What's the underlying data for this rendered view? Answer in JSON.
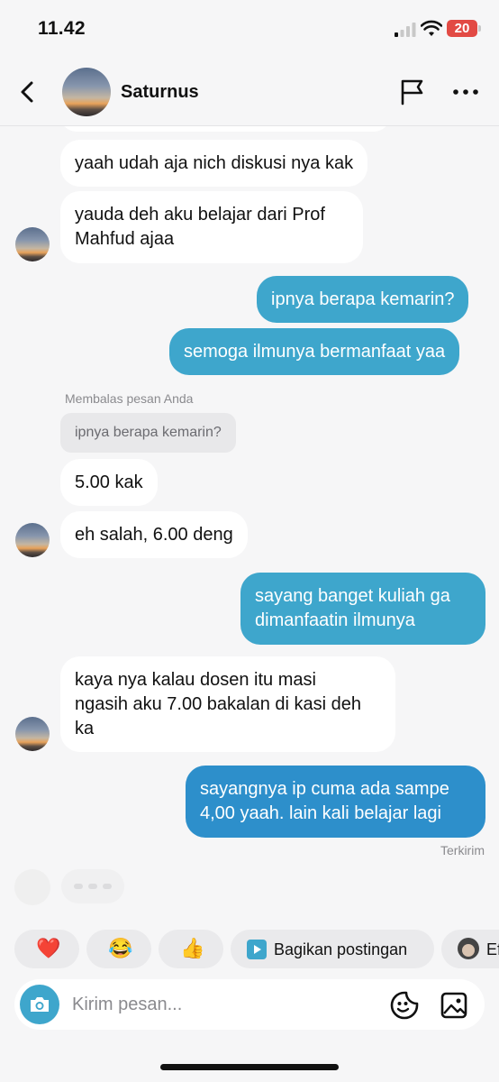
{
  "status_bar": {
    "time": "11.42",
    "battery": "20"
  },
  "header": {
    "contact_name": "Saturnus"
  },
  "chat": {
    "m1": "yaah udah aja nich diskusi nya kak",
    "m2_l1": "yauda deh aku belajar dari Prof",
    "m2_l2": "Mahfud ajaa",
    "m3": "ipnya berapa kemarin?",
    "m4": "semoga ilmunya bermanfaat yaa",
    "reply_label": "Membalas pesan Anda",
    "reply_quote": "ipnya berapa kemarin?",
    "m5": "5.00 kak",
    "m6": "eh salah, 6.00 deng",
    "m7_l1": "sayang banget kuliah ga",
    "m7_l2": "dimanfaatin ilmunya",
    "m8_l1": "kaya nya kalau dosen itu masi",
    "m8_l2": "ngasih aku 7.00 bakalan di kasi deh",
    "m8_l3": "ka",
    "m9_l1": "sayangnya ip cuma ada sampe",
    "m9_l2": "4,00 yaah. lain kali belajar lagi",
    "status": "Terkirim"
  },
  "reactions": {
    "heart": "❤️",
    "laugh": "😂",
    "thumbs": "👍",
    "share_label": "Bagikan postingan",
    "effects_label": "Ef"
  },
  "composer": {
    "placeholder": "Kirim pesan..."
  }
}
